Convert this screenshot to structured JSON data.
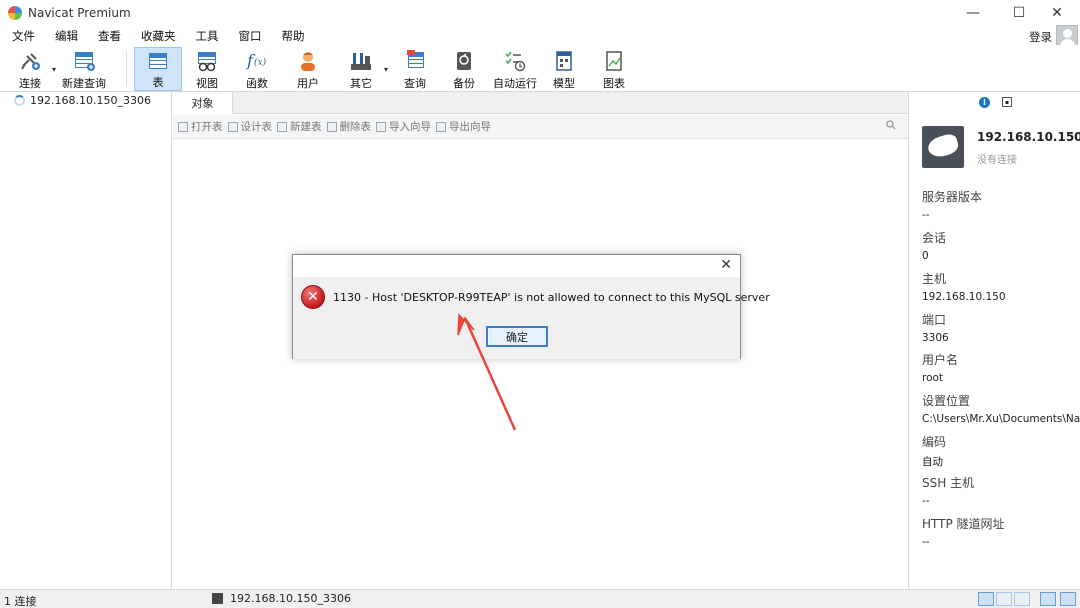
{
  "window": {
    "title": "Navicat Premium"
  },
  "menu": [
    "文件",
    "编辑",
    "查看",
    "收藏夹",
    "工具",
    "窗口",
    "帮助"
  ],
  "login_label": "登录",
  "toolbar": {
    "connect": "连接",
    "new_query": "新建查询",
    "table": "表",
    "view": "视图",
    "function": "函数",
    "user": "用户",
    "other": "其它",
    "query": "查询",
    "backup": "备份",
    "automation": "自动运行",
    "model": "模型",
    "chart": "图表"
  },
  "left": {
    "connection": "192.168.10.150_3306"
  },
  "tab": {
    "objects": "对象"
  },
  "object_toolbar": [
    "打开表",
    "设计表",
    "新建表",
    "删除表",
    "导入向导",
    "导出向导"
  ],
  "right": {
    "name": "192.168.10.150...",
    "status": "没有连接",
    "fields": [
      {
        "k": "服务器版本",
        "v": "--"
      },
      {
        "k": "会话",
        "v": "0"
      },
      {
        "k": "主机",
        "v": "192.168.10.150"
      },
      {
        "k": "端口",
        "v": "3306"
      },
      {
        "k": "用户名",
        "v": "root"
      },
      {
        "k": "设置位置",
        "v": "C:\\Users\\Mr.Xu\\Documents\\Na"
      },
      {
        "k": "编码",
        "v": "自动"
      },
      {
        "k": "SSH 主机",
        "v": "--"
      },
      {
        "k": "HTTP 隧道网址",
        "v": "--"
      }
    ]
  },
  "dialog": {
    "message": "1130 - Host 'DESKTOP-R99TEAP' is not allowed to connect to this MySQL server",
    "ok": "确定"
  },
  "status": {
    "left": "1 连接",
    "connection": "192.168.10.150_3306"
  },
  "colors": {
    "accent": "#3a7fc4",
    "error": "#c8171e",
    "annotation": "#e8463a"
  }
}
